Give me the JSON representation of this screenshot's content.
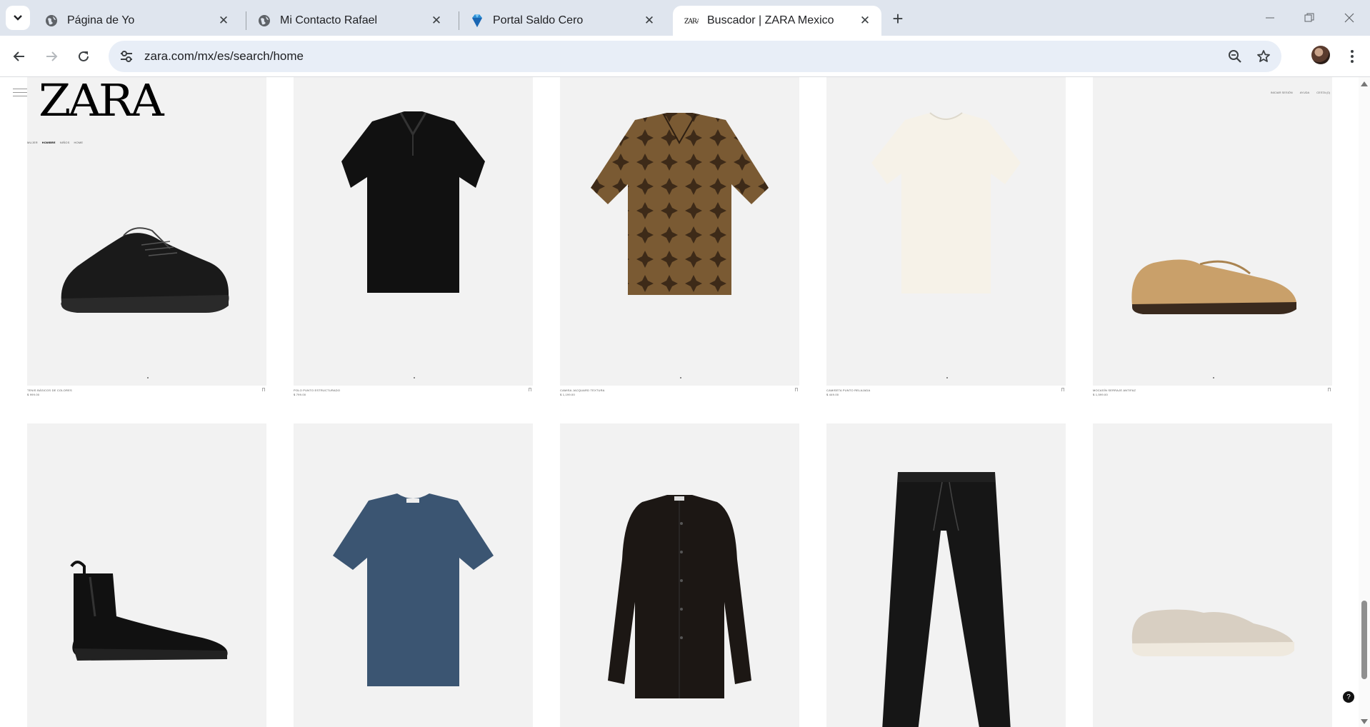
{
  "browser": {
    "tabs": [
      {
        "title": "Página de Yo",
        "icon": "globe-icon",
        "active": false
      },
      {
        "title": "Mi Contacto Rafael",
        "icon": "globe-icon",
        "active": false
      },
      {
        "title": "Portal Saldo Cero",
        "icon": "gem-icon",
        "active": false
      },
      {
        "title": "Buscador | ZARA Mexico",
        "icon": "zara-favicon",
        "active": true
      }
    ],
    "close_glyph": "✕",
    "new_tab_glyph": "+",
    "url": "zara.com/mx/es/search/home",
    "colors": {
      "tabbar": "#dfe5ee",
      "omnibox": "#e8eef7"
    }
  },
  "site": {
    "logo": "ZARA",
    "categories": [
      {
        "label": "MUJER",
        "active": false
      },
      {
        "label": "HOMBRE",
        "active": true
      },
      {
        "label": "NIÑOS",
        "active": false
      },
      {
        "label": "HOME",
        "active": false
      }
    ],
    "header_links": [
      "INICIAR SESIÓN",
      "AYUDA",
      "CESTA (0)"
    ],
    "help_glyph": "?"
  },
  "products": [
    {
      "name": "TENIS BÁSICOS DE COLORES",
      "price": "$ 999.00",
      "art": "sneaker",
      "color": "#1a1a1a"
    },
    {
      "name": "POLO PUNTO ESTRUCTURADO",
      "price": "$ 799.00",
      "art": "polo",
      "color": "#111111"
    },
    {
      "name": "CAMISA JACQUARD TEXTURA",
      "price": "$ 1,199.00",
      "art": "shirt-pattern",
      "color": "#7a5a33"
    },
    {
      "name": "CAMISETA PUNTO RELAJADA",
      "price": "$ 449.00",
      "art": "tee",
      "color": "#f6f2e8"
    },
    {
      "name": "MOCASÍN SERRAJE ANTIFAZ",
      "price": "$ 1,599.00",
      "art": "loafer",
      "color": "#c9a06a"
    },
    {
      "name": "",
      "price": "",
      "art": "chelsea",
      "color": "#111111"
    },
    {
      "name": "",
      "price": "",
      "art": "tee",
      "color": "#3b5572"
    },
    {
      "name": "",
      "price": "",
      "art": "overshirt",
      "color": "#1c1714"
    },
    {
      "name": "",
      "price": "",
      "art": "trousers",
      "color": "#161616"
    },
    {
      "name": "",
      "price": "",
      "art": "loafer",
      "color": "#d8cfc2"
    }
  ]
}
